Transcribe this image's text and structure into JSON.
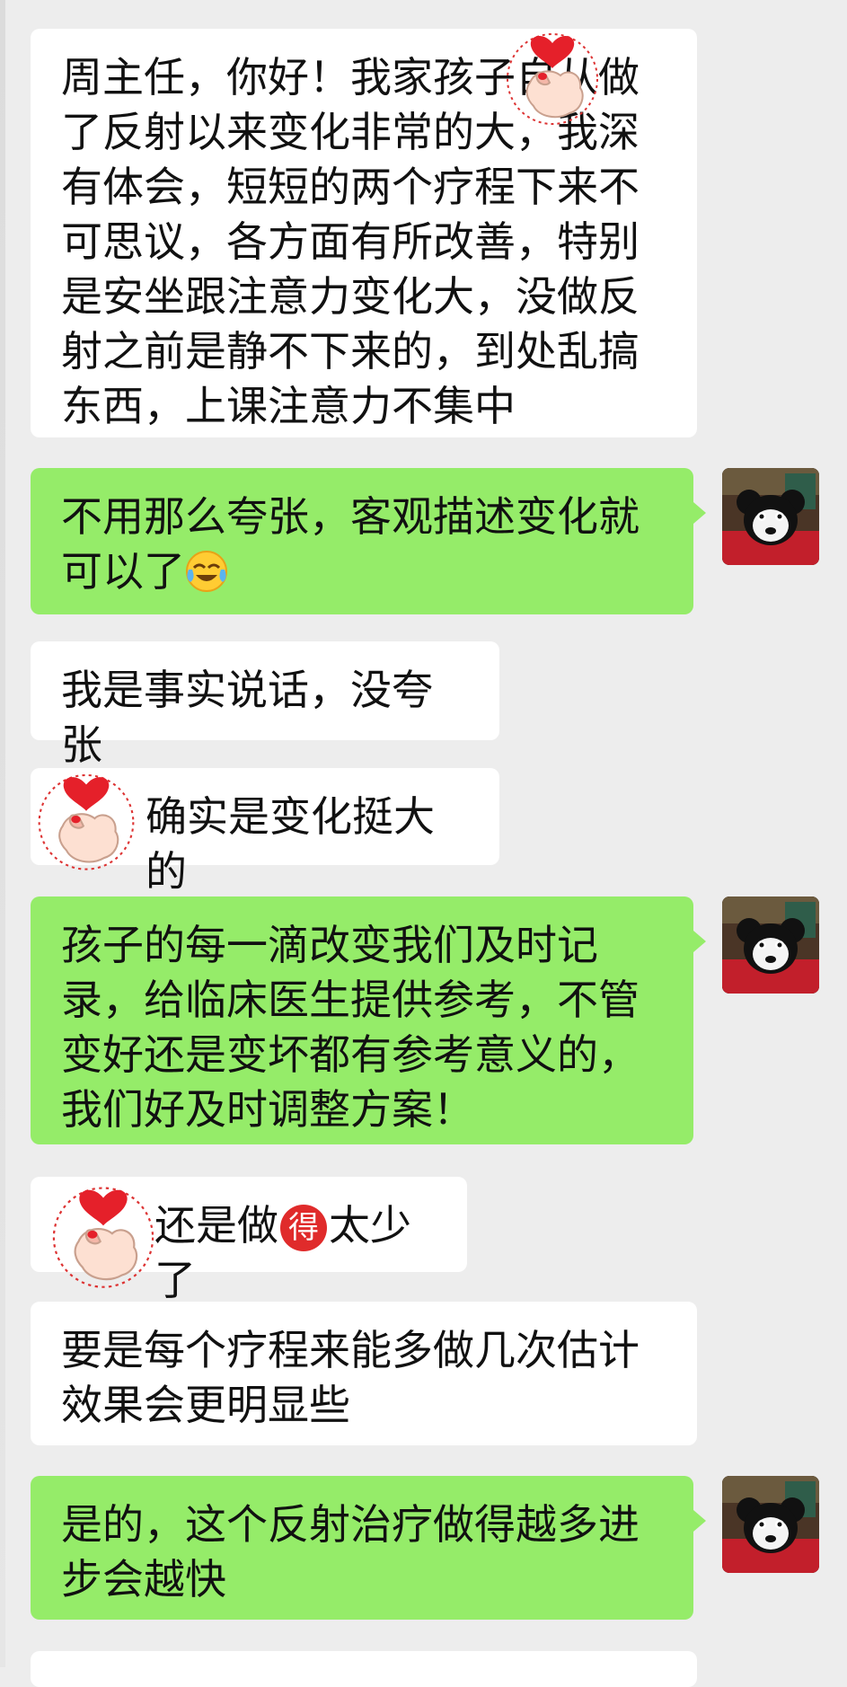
{
  "messages": [
    {
      "side": "in",
      "text": "周主任，你好！我家孩子自从做了反射以来变化非常的大，我深有体会，短短的两个疗程下来不可思议，各方面有所改善，特别是安坐跟注意力变化大，没做反射之前是静不下来的，到处乱搞东西，上课注意力不集中"
    },
    {
      "side": "out",
      "text": "不用那么夸张，客观描述变化就可以了",
      "emoji": "face-with-tears-of-joy-icon"
    },
    {
      "side": "in",
      "text": "我是事实说话，没夸张"
    },
    {
      "side": "in",
      "text": "确实是变化挺大的",
      "sticker": "finger-heart-sticker"
    },
    {
      "side": "out",
      "text": "孩子的每一滴改变我们及时记录，给临床医生提供参考，不管变好还是变坏都有参考意义的，我们好及时调整方案！"
    },
    {
      "side": "in",
      "text_before": "还是做",
      "badge": "得",
      "text_after": "太少了",
      "sticker": "finger-heart-sticker"
    },
    {
      "side": "in",
      "text": "要是每个疗程来能多做几次估计效果会更明显些"
    },
    {
      "side": "out",
      "text": "是的，这个反射治疗做得越多进步会越快"
    }
  ],
  "avatar_icon": "panda-bear-avatar-icon",
  "colors": {
    "background": "#ededed",
    "incoming_bubble": "#ffffff",
    "outgoing_bubble": "#95ec69",
    "badge": "#e02b2b"
  }
}
